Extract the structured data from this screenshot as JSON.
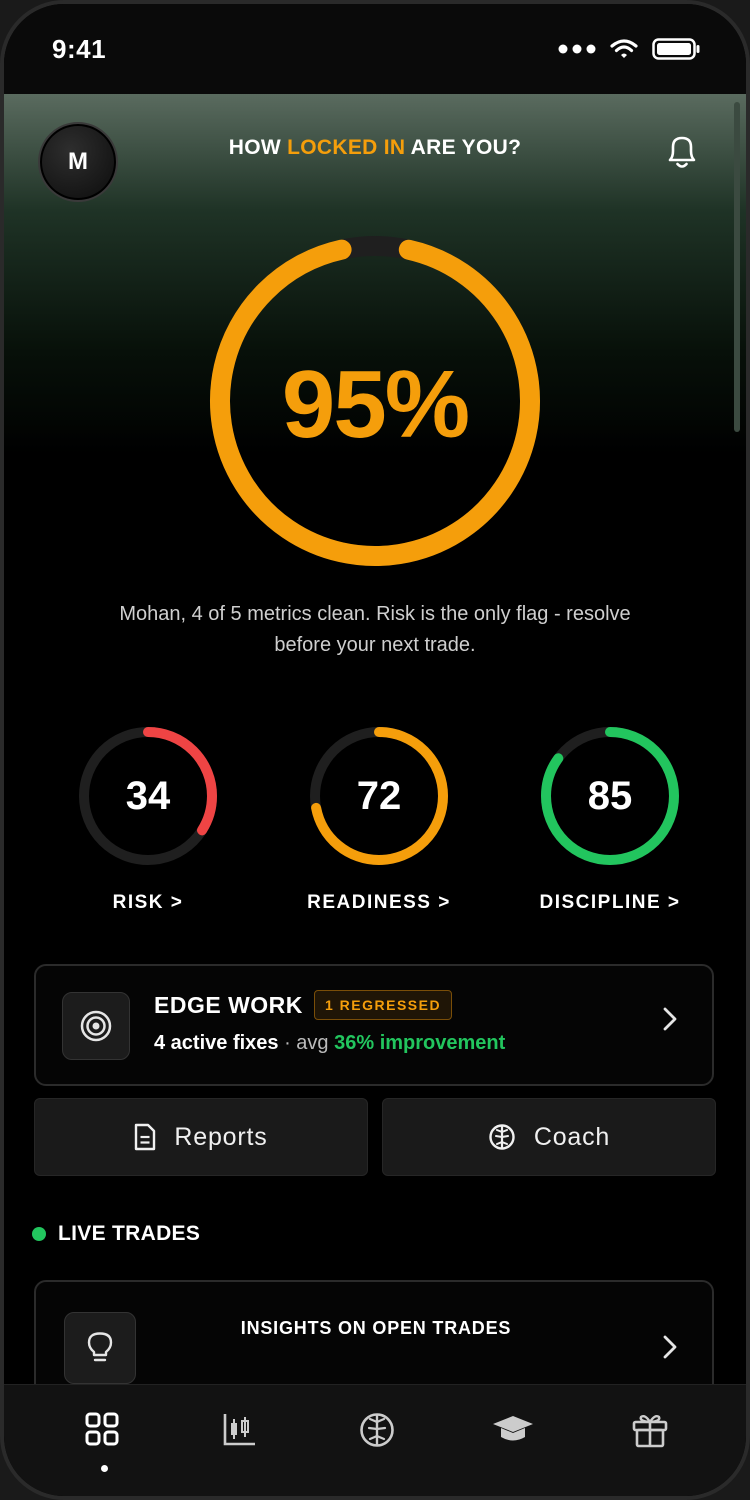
{
  "status_bar": {
    "time": "9:41"
  },
  "header": {
    "avatar_initial": "M",
    "headline_pre": "HOW ",
    "headline_accent": "LOCKED IN",
    "headline_post": " ARE YOU?"
  },
  "score": {
    "value_text": "95%",
    "value": 95,
    "max": 100,
    "color": "#f59e0b"
  },
  "summary": "Mohan, 4 of 5 metrics clean. Risk is the only flag - resolve before your next trade.",
  "metrics": [
    {
      "label": "RISK >",
      "value": "34",
      "level": 34,
      "color": "#ef4444"
    },
    {
      "label": "READINESS >",
      "value": "72",
      "level": 72,
      "color": "#f59e0b"
    },
    {
      "label": "DISCIPLINE >",
      "value": "85",
      "level": 85,
      "color": "#22c55e"
    }
  ],
  "edge_work": {
    "title": "EDGE WORK",
    "badge": "1 REGRESSED",
    "fixes": "4 active fixes",
    "sep": " · avg ",
    "improvement": "36% improvement",
    "icon": "target-icon"
  },
  "buttons": {
    "reports": "Reports",
    "coach": "Coach"
  },
  "live": {
    "label": "LIVE TRADES",
    "card_title": "INSIGHTS ON OPEN TRADES",
    "icon": "lightbulb-icon"
  },
  "tabbar": {
    "active": "dashboard",
    "tabs": [
      "dashboard-icon",
      "candlestick-chart-icon",
      "brain-icon",
      "graduation-cap-icon",
      "gift-icon"
    ]
  },
  "colors": {
    "accent": "#f59e0b",
    "green": "#22c55e",
    "red": "#ef4444",
    "track": "#1f1f1f"
  }
}
